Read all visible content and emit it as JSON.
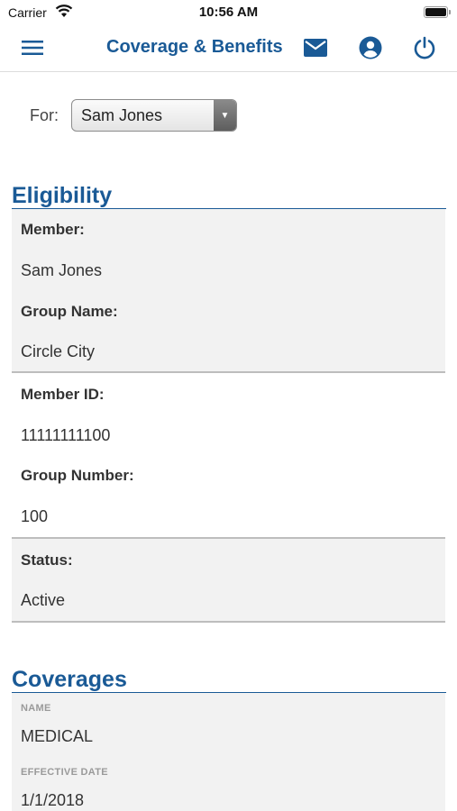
{
  "status_bar": {
    "carrier": "Carrier",
    "time": "10:56 AM"
  },
  "nav": {
    "title": "Coverage & Benefits",
    "icons": [
      "menu-icon",
      "mail-icon",
      "account-icon",
      "power-icon"
    ]
  },
  "selector": {
    "label": "For:",
    "value": "Sam Jones"
  },
  "eligibility": {
    "title": "Eligibility",
    "member_label": "Member:",
    "member_value": "Sam Jones",
    "group_name_label": "Group Name:",
    "group_name_value": "Circle City",
    "member_id_label": "Member ID:",
    "member_id_value": "11111111100",
    "group_number_label": "Group Number:",
    "group_number_value": "100",
    "status_label": "Status:",
    "status_value": "Active"
  },
  "coverages": {
    "title": "Coverages",
    "name_label": "NAME",
    "name_value": "MEDICAL",
    "effective_date_label": "EFFECTIVE DATE",
    "effective_date_value": "1/1/2018"
  },
  "colors": {
    "accent": "#1a5a96",
    "panel": "#f2f2f2"
  }
}
